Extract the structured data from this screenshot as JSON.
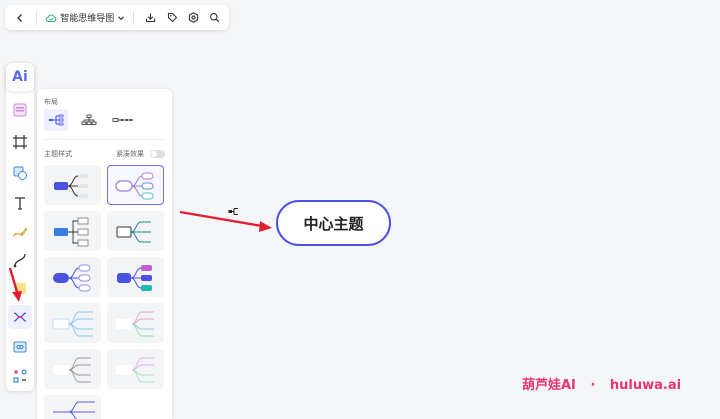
{
  "topbar": {
    "doc_title": "智能思维导图",
    "icons": [
      "back-icon",
      "cloud-saved-icon",
      "chevron-down-icon",
      "download-icon",
      "tag-icon",
      "settings-icon",
      "search-icon"
    ]
  },
  "sidebar": {
    "ai_label": "Ai",
    "items": [
      "template-icon",
      "frame-icon",
      "shape-icon",
      "text-icon",
      "pen-icon",
      "connector-icon",
      "sticky-note-icon",
      "mindmap-icon",
      "embed-icon",
      "more-apps-icon"
    ]
  },
  "panel": {
    "layout_label": "布局",
    "theme_label": "主题样式",
    "compact_label": "紧凑效果"
  },
  "canvas": {
    "central_topic": "中心主题"
  },
  "watermark": {
    "brand": "葫芦娃AI",
    "dot": "·",
    "site": "huluwa.ai"
  },
  "colors": {
    "accent": "#4a52e0",
    "annotation_arrow": "#e02030",
    "watermark": "#e8356e"
  }
}
